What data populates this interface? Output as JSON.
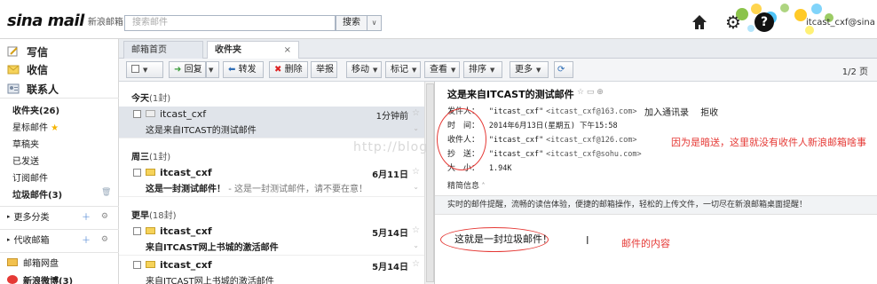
{
  "header": {
    "logo_text": "sina mail",
    "logo_sub": "新浪邮箱",
    "search_placeholder": "搜索邮件",
    "search_button": "搜索",
    "search_dropdown": "∨",
    "user": "itcast_cxf@sina"
  },
  "sidebar": {
    "write": "写信",
    "inbox": "收信",
    "contacts": "联系人",
    "folders": [
      {
        "label": "收件夹(26)",
        "bold": true
      },
      {
        "label": "星标邮件",
        "bold": false
      },
      {
        "label": "草稿夹",
        "bold": false
      },
      {
        "label": "已发送",
        "bold": false
      },
      {
        "label": "订阅邮件",
        "bold": false
      },
      {
        "label": "垃圾邮件(3)",
        "bold": true
      }
    ],
    "more_categories": "更多分类",
    "proxy_mailbox": "代收邮箱",
    "netdisk": "邮箱网盘",
    "weibo": "新浪微博(3)"
  },
  "tabs": {
    "home": "邮箱首页",
    "inbox": "收件夹",
    "close": "×"
  },
  "toolbar": {
    "reply": "回复",
    "forward": "转发",
    "delete": "删除",
    "report": "举报",
    "move": "移动",
    "tag": "标记",
    "view": "查看",
    "sort": "排序",
    "more": "更多",
    "pager": "1/2 页"
  },
  "list": {
    "groups": [
      {
        "label": "今天",
        "count": "(1封)"
      },
      {
        "label": "周三",
        "count": "(1封)"
      },
      {
        "label": "更早",
        "count": "(18封)"
      }
    ],
    "rows": [
      {
        "sender": "itcast_cxf",
        "subject": "这是来自ITCAST的测试邮件",
        "preview": "",
        "time": "1分钟前"
      },
      {
        "sender": "itcast_cxf",
        "subject": "这是一封测试邮件！",
        "preview": "- 这是一封测试邮件，请不要在意！",
        "time": "6月11日"
      },
      {
        "sender": "itcast_cxf",
        "subject": "来自ITCAST网上书城的激活邮件",
        "preview": "",
        "time": "5月14日"
      },
      {
        "sender": "itcast_cxf",
        "subject": "来自ITCAST网上书城的激活邮件",
        "preview": "",
        "time": "5月14日"
      }
    ]
  },
  "reader": {
    "subject": "这是来自ITCAST的测试邮件",
    "from_label": "发件人：",
    "from_name": "\"itcast_cxf\"",
    "from_addr": "<itcast_cxf@163.com>",
    "add_contact": "加入通讯录",
    "reject": "拒收",
    "time_label": "时　间：",
    "time_value": "2014年6月13日(星期五) 下午15:58",
    "to_label": "收件人：",
    "to_name": "\"itcast_cxf\"",
    "to_addr": "<itcast_cxf@126.com>",
    "cc_label": "抄　送：",
    "cc_name": "\"itcast_cxf\"",
    "cc_addr": "<itcast_cxf@sohu.com>",
    "size_label": "大　小：",
    "size_value": "1.94K",
    "detail": "精简信息",
    "tip": "实时的邮件提醒，流畅的读信体验，便捷的邮箱操作，轻松的上传文件，一切尽在新浪邮箱桌面提醒！",
    "body": "这就是一封垃圾邮件！"
  },
  "annotations": {
    "bcc_note": "因为是暗送，这里就没有收件人新浪邮箱啥事",
    "content_note": "邮件的内容",
    "watermark": "http://blog"
  },
  "colors": {
    "accent_red": "#e53935",
    "selected_row": "#e0e4ea"
  }
}
